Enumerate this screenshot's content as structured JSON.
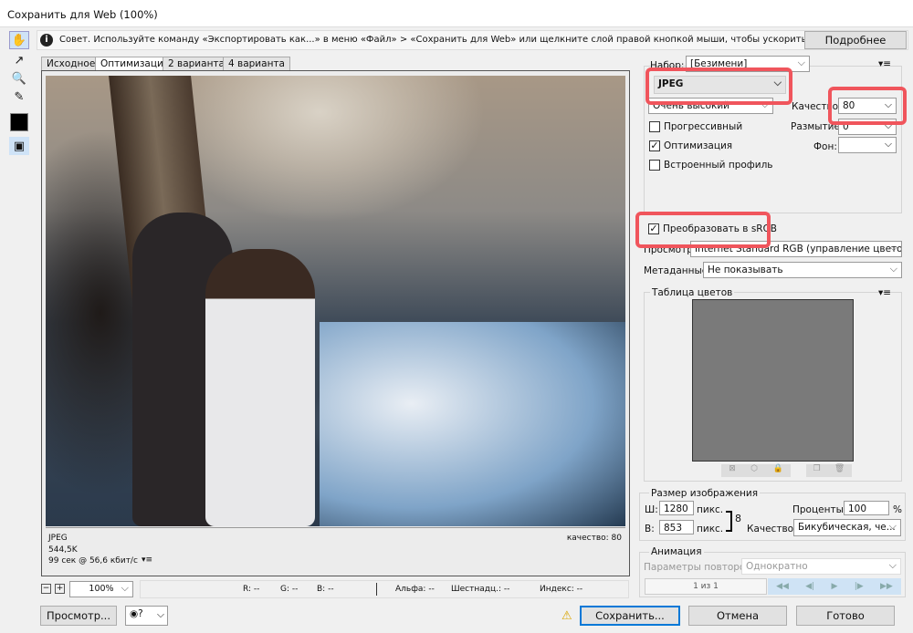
{
  "window": {
    "title": "Сохранить для Web (100%)"
  },
  "tip": {
    "text": "Совет. Используйте команду «Экспортировать как...» в меню «Файл» > «Сохранить для Web» или щелкните слой правой кнопкой мыши, чтобы ускорить экспорт ресурсов",
    "more_button": "Подробнее"
  },
  "tabs": [
    {
      "label": "Исходное"
    },
    {
      "label": "Оптимизация",
      "active": true
    },
    {
      "label": "2 варианта"
    },
    {
      "label": "4 варианта"
    }
  ],
  "image_info": {
    "format": "JPEG",
    "size": "544,5K",
    "time": "99 сек @ 56,6 кбит/с",
    "quality": "качество: 80"
  },
  "zoom": {
    "value": "100%"
  },
  "readout": {
    "r": "R: --",
    "g": "G: --",
    "b": "B: --",
    "alpha": "Альфа: --",
    "hex": "Шестнадц.: --",
    "index": "Индекс: --"
  },
  "settings": {
    "preset_label": "Набор:",
    "preset_value": "[Безимени]",
    "format": "JPEG",
    "quality_preset": "Очень высокий",
    "quality_label": "Качество:",
    "quality_value": "80",
    "progressive_label": "Прогрессивный",
    "progressive": false,
    "blur_label": "Размытие:",
    "blur_value": "0",
    "optimized_label": "Оптимизация",
    "optimized": true,
    "matte_label": "Фон:",
    "matte_value": "",
    "embed_profile_label": "Встроенный профиль",
    "embed_profile": false,
    "srgb_label": "Преобразовать в sRGB",
    "srgb": true,
    "preview_label": "Просмотр:",
    "preview_value": "Internet Standard RGB (управление цвето...",
    "metadata_label": "Метаданные:",
    "metadata_value": "Не показывать"
  },
  "color_table": {
    "title": "Таблица цветов"
  },
  "image_size": {
    "title": "Размер изображения",
    "w_label": "Ш:",
    "w_value": "1280",
    "h_label": "В:",
    "h_value": "853",
    "unit": "пикс.",
    "percent_label": "Проценты:",
    "percent_value": "100",
    "percent_sign": "%",
    "quality_label": "Качество:",
    "quality_value": "Бикубическая, че..."
  },
  "animation": {
    "title": "Анимация",
    "loop_label": "Параметры повторов:",
    "loop_value": "Однократно",
    "frame": "1 из 1"
  },
  "buttons": {
    "preview": "Просмотр...",
    "save": "Сохранить...",
    "cancel": "Отмена",
    "done": "Готово"
  },
  "colors": {
    "highlight": "#f0555c",
    "accent": "#0078d7"
  }
}
